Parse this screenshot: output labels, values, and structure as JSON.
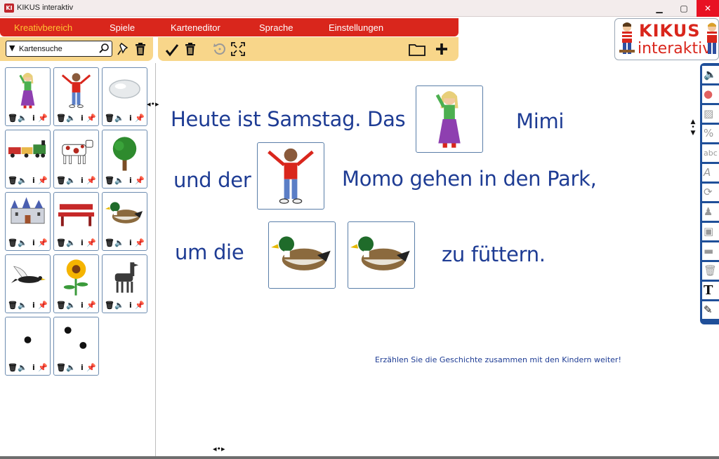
{
  "window": {
    "title": "KIKUS interaktiv",
    "icon_text": "KI",
    "min": "▁",
    "max": "▢",
    "close": "✕"
  },
  "menu": {
    "items": [
      {
        "label": "Kreativbereich",
        "active": true
      },
      {
        "label": "Spiele"
      },
      {
        "label": "Karteneditor"
      },
      {
        "label": "Sprache"
      },
      {
        "label": "Einstellungen"
      }
    ]
  },
  "search": {
    "placeholder": "Kartensuche",
    "dropdown_glyph": "▼"
  },
  "logo": {
    "line1": "KIKUS",
    "line2": "interaktiv"
  },
  "cards": [
    {
      "image": "girl-icon"
    },
    {
      "image": "boy-icon"
    },
    {
      "image": "stone-icon"
    },
    {
      "image": "train-icon"
    },
    {
      "image": "cow-icon"
    },
    {
      "image": "tree-icon"
    },
    {
      "image": "castle-icon"
    },
    {
      "image": "bench-icon"
    },
    {
      "image": "duck-icon"
    },
    {
      "image": "bird-icon"
    },
    {
      "image": "sunflower-icon"
    },
    {
      "image": "llama-icon"
    },
    {
      "image": "one-dot-icon"
    },
    {
      "image": "two-dots-icon"
    }
  ],
  "card_controls": {
    "delete": "🗑",
    "sound": "🔈",
    "info": "i",
    "pin": "📌"
  },
  "story": {
    "line1_a": "Heute ist Samstag. Das",
    "line1_b": "Mimi",
    "line2_a": "und der",
    "line2_b": "Momo gehen in den Park,",
    "line3_a": "um die",
    "line3_b": "zu füttern.",
    "images": [
      "girl-icon",
      "boy-icon",
      "duck-icon",
      "duck-icon"
    ]
  },
  "hint": "Erzählen Sie die Geschichte zusammen mit den Kindern weiter!",
  "right_toolbar": [
    {
      "icon": "speaker-icon",
      "glyph": "🔈"
    },
    {
      "icon": "color-dots-icon",
      "glyph": "●"
    },
    {
      "icon": "hatch-icon",
      "glyph": "▨"
    },
    {
      "icon": "percent-icon",
      "glyph": "%"
    },
    {
      "icon": "abc-icon",
      "glyph": "abc"
    },
    {
      "icon": "font-a-icon",
      "glyph": "A"
    },
    {
      "icon": "rotate-icon",
      "glyph": "⟳"
    },
    {
      "icon": "figure-icon",
      "glyph": "♟"
    },
    {
      "icon": "image-icon",
      "glyph": "▣"
    },
    {
      "icon": "card-icon",
      "glyph": "▬"
    },
    {
      "icon": "trash-icon",
      "glyph": "🗑"
    },
    {
      "icon": "text-t-icon",
      "glyph": "T"
    },
    {
      "icon": "pencil-icon",
      "glyph": "✎"
    }
  ],
  "colors": {
    "menu_red": "#d9261c",
    "toolbar_yellow": "#f8d68a",
    "story_blue": "#1e3c94",
    "active_orange": "#ffc233"
  }
}
